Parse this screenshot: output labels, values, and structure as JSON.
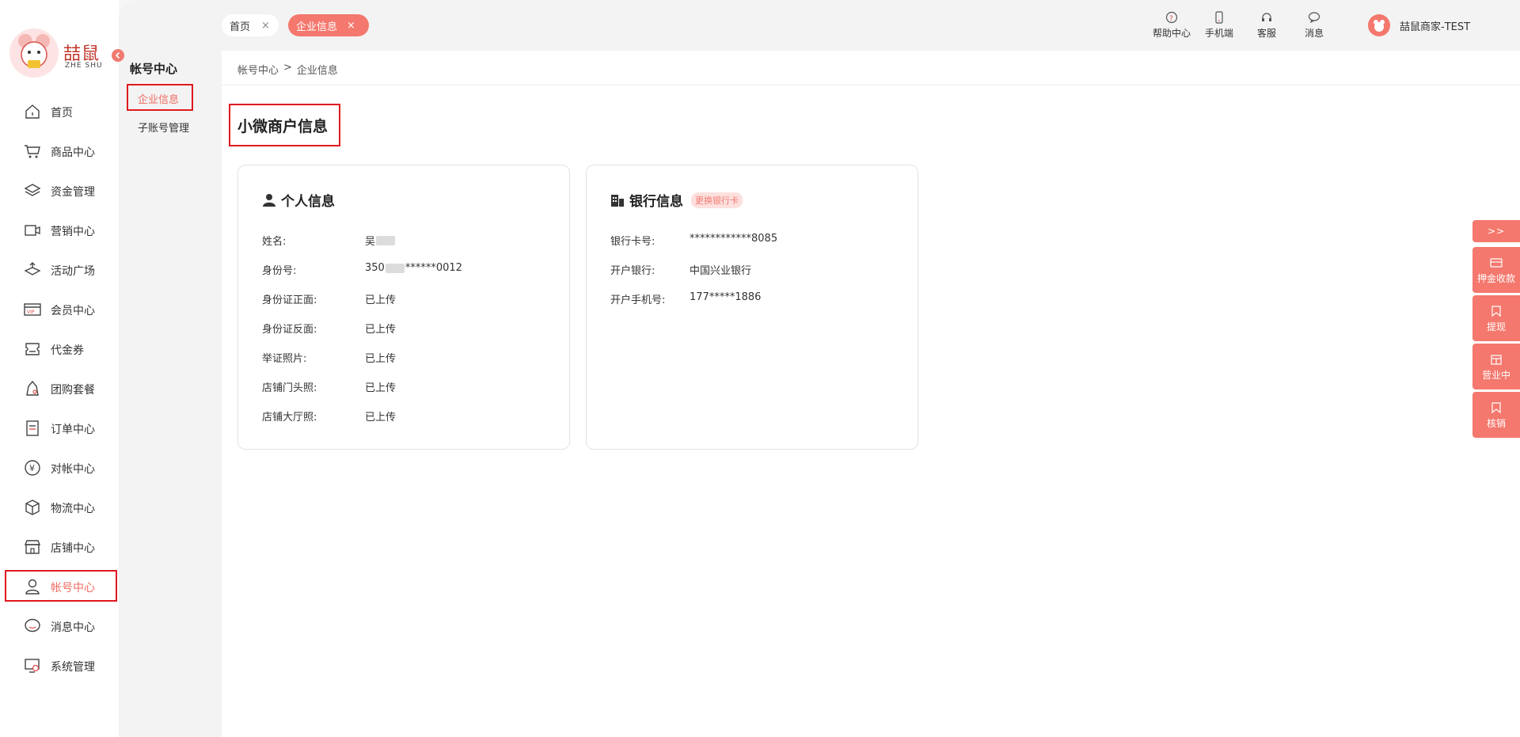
{
  "logo": {
    "cn": "喆鼠",
    "en": "ZHE SHU"
  },
  "left_nav": {
    "items": [
      {
        "label": "首页",
        "icon": "home-icon"
      },
      {
        "label": "商品中心",
        "icon": "cart-icon"
      },
      {
        "label": "资金管理",
        "icon": "layers-icon"
      },
      {
        "label": "营销中心",
        "icon": "marketing-icon"
      },
      {
        "label": "活动广场",
        "icon": "activity-icon"
      },
      {
        "label": "会员中心",
        "icon": "vip-card-icon"
      },
      {
        "label": "代金券",
        "icon": "coupon-icon"
      },
      {
        "label": "团购套餐",
        "icon": "group-buy-icon"
      },
      {
        "label": "订单中心",
        "icon": "order-icon"
      },
      {
        "label": "对帐中心",
        "icon": "yen-icon"
      },
      {
        "label": "物流中心",
        "icon": "box-icon"
      },
      {
        "label": "店铺中心",
        "icon": "store-icon"
      },
      {
        "label": "帐号中心",
        "icon": "user-icon",
        "active": true
      },
      {
        "label": "消息中心",
        "icon": "message-icon"
      },
      {
        "label": "系统管理",
        "icon": "settings-icon"
      }
    ]
  },
  "sub_nav": {
    "title": "帐号中心",
    "items": [
      {
        "label": "企业信息",
        "active": true
      },
      {
        "label": "子账号管理"
      }
    ]
  },
  "tabs": [
    {
      "label": "首页",
      "close": "×"
    },
    {
      "label": "企业信息",
      "close": "×",
      "active": true
    }
  ],
  "toolbar": {
    "help": "帮助中心",
    "mobile": "手机端",
    "service": "客服",
    "messages": "消息"
  },
  "user": {
    "name": "喆鼠商家-TEST"
  },
  "breadcrumb": {
    "root": "帐号中心",
    "sep": ">",
    "current": "企业信息"
  },
  "page": {
    "title": "小微商户信息"
  },
  "personal": {
    "title": "个人信息",
    "rows": [
      {
        "key": "姓名:",
        "prefix": "吴",
        "suffix": ""
      },
      {
        "key": "身份号:",
        "prefix": "350",
        "suffix": "******0012"
      },
      {
        "key": "身份证正面:",
        "value": "已上传"
      },
      {
        "key": "身份证反面:",
        "value": "已上传"
      },
      {
        "key": "举证照片:",
        "value": "已上传"
      },
      {
        "key": "店铺门头照:",
        "value": "已上传"
      },
      {
        "key": "店铺大厅照:",
        "value": "已上传"
      }
    ]
  },
  "bank": {
    "title": "银行信息",
    "change_label": "更换银行卡",
    "rows": [
      {
        "key": "银行卡号:",
        "value": "************8085"
      },
      {
        "key": "开户银行:",
        "value": "中国兴业银行"
      },
      {
        "key": "开户手机号:",
        "value": "177*****1886"
      }
    ]
  },
  "float_bar": {
    "toggle": ">>",
    "buttons": [
      {
        "label": "押金收款",
        "icon": "card-icon"
      },
      {
        "label": "提现",
        "icon": "bookmark-icon"
      },
      {
        "label": "营业中",
        "icon": "shop-icon"
      },
      {
        "label": "核销",
        "icon": "bookmark-icon"
      }
    ]
  },
  "colors": {
    "accent": "#f4786d",
    "highlight": "#e0191f"
  }
}
